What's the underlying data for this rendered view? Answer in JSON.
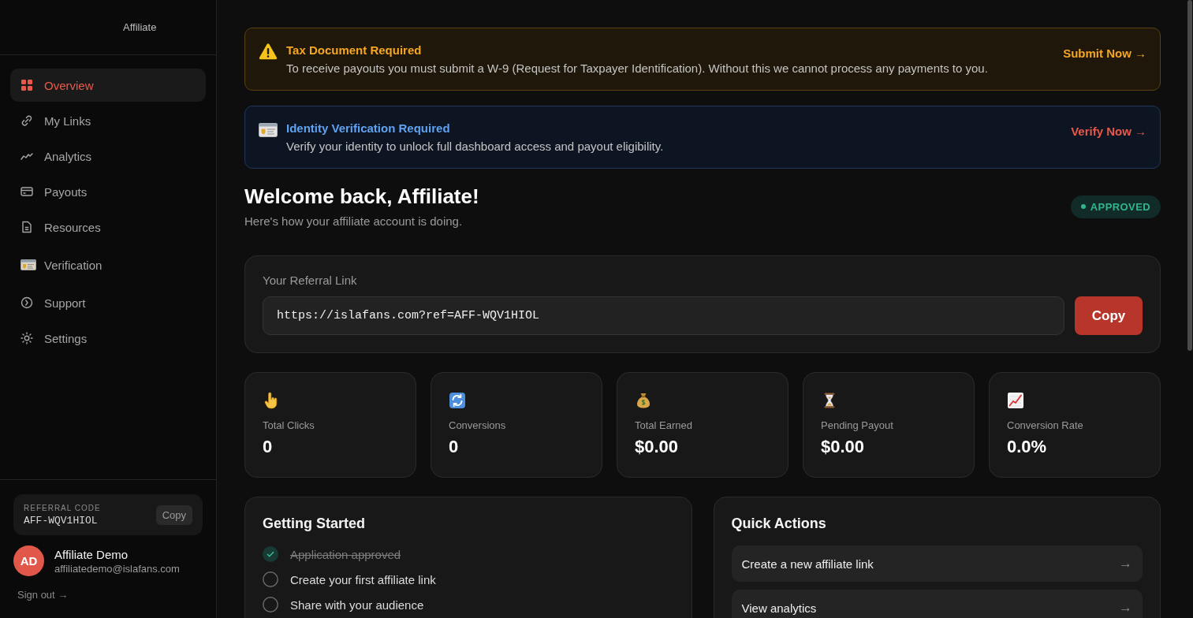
{
  "sidebar": {
    "brand": "Affiliate",
    "nav": [
      {
        "label": "Overview",
        "selected": true
      },
      {
        "label": "My Links",
        "selected": false
      },
      {
        "label": "Analytics",
        "selected": false
      },
      {
        "label": "Payouts",
        "selected": false
      },
      {
        "label": "Resources",
        "selected": false
      },
      {
        "label": "Verification",
        "selected": false
      },
      {
        "label": "Support",
        "selected": false
      },
      {
        "label": "Settings",
        "selected": false
      }
    ],
    "referral_code": {
      "label": "REFERRAL CODE",
      "code": "AFF-WQV1HIOL",
      "button": "Copy"
    },
    "user": {
      "initials": "AD",
      "name": "Affiliate Demo",
      "email": "affiliatedemo@islafans.com"
    },
    "sign_out": "Sign out →"
  },
  "alerts": [
    {
      "kind": "warning",
      "title": "Tax Document Required",
      "message": "To receive payouts you must submit a W-9 (Request for Taxpayer Identification). Without this we cannot process any payments to you.",
      "action": "Submit Now →"
    },
    {
      "kind": "verification",
      "title": "Identity Verification Required",
      "message": "Verify your identity to unlock full dashboard access and payout eligibility.",
      "action": "Verify Now →"
    }
  ],
  "header": {
    "title": "Welcome back, Affiliate!",
    "subtitle": "Here's how your affiliate account is doing.",
    "status": "APPROVED"
  },
  "referral_link": {
    "label": "Your Referral Link",
    "value": "https://islafans.com?ref=AFF-WQV1HIOL",
    "button": "Copy"
  },
  "stats": [
    {
      "label": "Total Clicks",
      "value": "0"
    },
    {
      "label": "Conversions",
      "value": "0"
    },
    {
      "label": "Total Earned",
      "value": "$0.00"
    },
    {
      "label": "Pending Payout",
      "value": "$0.00"
    },
    {
      "label": "Conversion Rate",
      "value": "0.0%"
    }
  ],
  "getting_started": {
    "title": "Getting Started",
    "steps": [
      {
        "label": "Application approved",
        "checked": true
      },
      {
        "label": "Create your first affiliate link",
        "checked": false
      },
      {
        "label": "Share with your audience",
        "checked": false
      }
    ]
  },
  "quick_actions": {
    "title": "Quick Actions",
    "items": [
      {
        "label": "Create a new affiliate link",
        "arrow": "→"
      },
      {
        "label": "View analytics",
        "arrow": "→"
      }
    ]
  }
}
